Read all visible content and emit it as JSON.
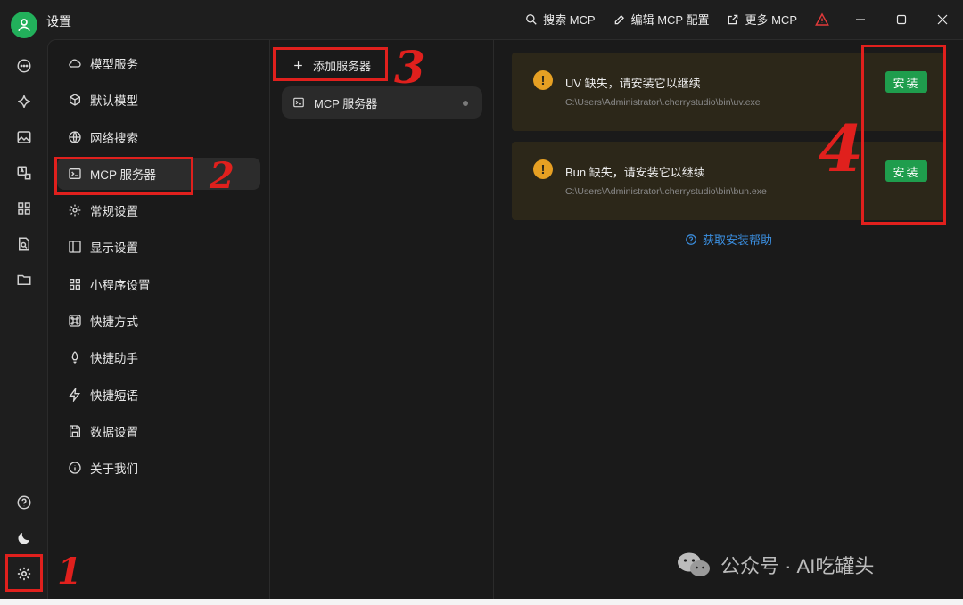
{
  "window": {
    "title": "设置",
    "top_actions": [
      {
        "label": "搜索 MCP",
        "icon": "search-icon"
      },
      {
        "label": "编辑 MCP 配置",
        "icon": "edit-icon"
      },
      {
        "label": "更多 MCP",
        "icon": "external-link-icon"
      }
    ]
  },
  "rail": {
    "top_icons": [
      "chat-icon",
      "sparkle-icon",
      "image-icon",
      "translate-icon",
      "grid-icon",
      "file-search-icon",
      "folder-icon"
    ],
    "bottom_icons": [
      "help-icon",
      "moon-icon",
      "gear-icon"
    ]
  },
  "settings_nav": {
    "items": [
      {
        "label": "模型服务",
        "icon": "cloud-icon"
      },
      {
        "label": "默认模型",
        "icon": "cube-icon"
      },
      {
        "label": "网络搜索",
        "icon": "globe-icon"
      },
      {
        "label": "MCP 服务器",
        "icon": "terminal-icon",
        "active": true
      },
      {
        "label": "常规设置",
        "icon": "settings-icon"
      },
      {
        "label": "显示设置",
        "icon": "layout-icon"
      },
      {
        "label": "小程序设置",
        "icon": "apps-icon"
      },
      {
        "label": "快捷方式",
        "icon": "command-icon"
      },
      {
        "label": "快捷助手",
        "icon": "rocket-icon"
      },
      {
        "label": "快捷短语",
        "icon": "zap-icon"
      },
      {
        "label": "数据设置",
        "icon": "save-icon"
      },
      {
        "label": "关于我们",
        "icon": "info-icon"
      }
    ]
  },
  "server_list": {
    "add_label": "添加服务器",
    "servers": [
      {
        "label": "MCP 服务器"
      }
    ]
  },
  "alerts": [
    {
      "title": "UV 缺失，请安装它以继续",
      "path": "C:\\Users\\Administrator\\.cherrystudio\\bin\\uv.exe",
      "button": "安装"
    },
    {
      "title": "Bun 缺失，请安装它以继续",
      "path": "C:\\Users\\Administrator\\.cherrystudio\\bin\\bun.exe",
      "button": "安装"
    }
  ],
  "help_link": "获取安装帮助",
  "annotations": [
    "1",
    "2",
    "3",
    "4"
  ],
  "watermark": "公众号 · AI吃罐头",
  "colors": {
    "accent_green": "#1f9d4d",
    "warning": "#e6a023",
    "link": "#3b8fe0",
    "annotation_red": "#e0201d"
  }
}
